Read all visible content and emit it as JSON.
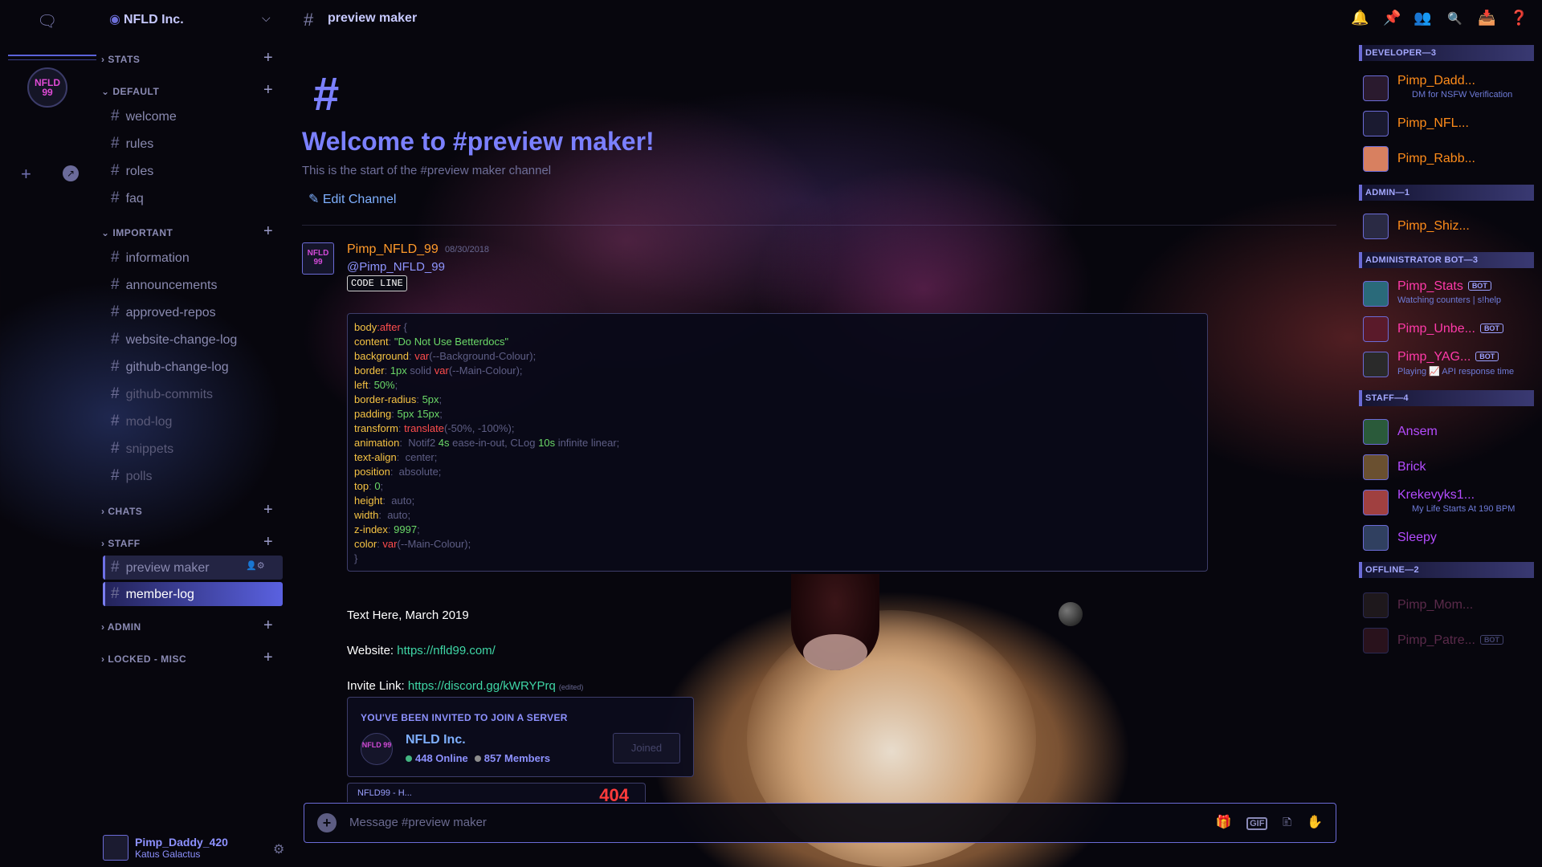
{
  "server": {
    "name": "NFLD Inc.",
    "icon_text": "NFLD 99"
  },
  "rail": {
    "dm_icon": "chat-bubble-icon",
    "add_icon": "+",
    "explore_icon": "compass-icon"
  },
  "categories": [
    {
      "name": "STATS",
      "channels": []
    },
    {
      "name": "DEFAULT",
      "channels": [
        "welcome",
        "rules",
        "roles",
        "faq"
      ]
    },
    {
      "name": "IMPORTANT",
      "channels": [
        "information",
        "announcements",
        "approved-repos",
        "website-change-log",
        "github-change-log",
        "github-commits",
        "mod-log",
        "snippets",
        "polls"
      ]
    },
    {
      "name": "CHATS",
      "channels": []
    },
    {
      "name": "STAFF",
      "channels": [
        "preview maker",
        "member-log"
      ]
    },
    {
      "name": "ADMIN",
      "channels": []
    },
    {
      "name": "LOCKED - MISC",
      "channels": []
    }
  ],
  "user_panel": {
    "name": "Pimp_Daddy_420",
    "status": "Katus Galactus"
  },
  "header": {
    "channel": "preview maker"
  },
  "welcome": {
    "title": "Welcome to #preview maker!",
    "subtitle": "This is the start of the #preview maker channel",
    "edit": "Edit Channel"
  },
  "message": {
    "author": "Pimp_NFLD_99",
    "date": "08/30/2018",
    "mention": "@Pimp_NFLD_99",
    "code_inline": "CODE LINE",
    "text1": "Text Here, March 2019",
    "website_label": "Website:",
    "website_url": "https://nfld99.com/",
    "invite_label": "Invite Link:",
    "invite_url": "https://discord.gg/kWRYPrq",
    "edited": "(edited)"
  },
  "code_block": {
    "selector": "body",
    "pseudo": ":after",
    "open": " {",
    "close": "}",
    "lines": [
      {
        "prop": "content",
        "val": "\"Do Not Use Betterdocs\"",
        "kind": "s"
      },
      {
        "prop": "background",
        "fn": "var",
        "arg": "(--Background-Colour);"
      },
      {
        "prop": "border",
        "num": "1px",
        "rest": " solid ",
        "fn": "var",
        "arg": "(--Main-Colour);"
      },
      {
        "prop": "left",
        "num": "50%",
        "rest": ";"
      },
      {
        "prop": "border-radius",
        "num": "5px",
        "rest": ";"
      },
      {
        "prop": "padding",
        "num": "5px 15px",
        "rest": ";"
      },
      {
        "prop": "transform",
        "fn": "translate",
        "arg": "(-50%, -100%);"
      },
      {
        "prop": "animation",
        "rest": " Notif2 ",
        "num": "4s",
        "rest2": " ease-in-out, CLog ",
        "num2": "10s",
        "rest3": " infinite linear;"
      },
      {
        "prop": "text-align",
        "rest": " center;"
      },
      {
        "prop": "position",
        "rest": " absolute;"
      },
      {
        "prop": "top",
        "num": "0",
        "rest": ";"
      },
      {
        "prop": "height",
        "rest": " auto;"
      },
      {
        "prop": "width",
        "rest": " auto;"
      },
      {
        "prop": "z-index",
        "num": "9997",
        "rest": ";"
      },
      {
        "prop": "color",
        "fn": "var",
        "arg": "(--Main-Colour);"
      }
    ]
  },
  "invite": {
    "heading": "YOU'VE BEEN INVITED TO JOIN A SERVER",
    "name": "NFLD Inc.",
    "online": "448 Online",
    "members": "857 Members",
    "button": "Joined"
  },
  "embed_peek": {
    "title": "NFLD99 - H...",
    "number": "404"
  },
  "input": {
    "placeholder": "Message #preview maker"
  },
  "members": {
    "groups": [
      {
        "heading": "DEVELOPER—3",
        "items": [
          {
            "name": "Pimp_Dadd...",
            "sub": "DM for NSFW Verification",
            "color": "orange"
          },
          {
            "name": "Pimp_NFL...",
            "sub": "",
            "color": "orange"
          },
          {
            "name": "Pimp_Rabb...",
            "sub": "",
            "color": "orange"
          }
        ]
      },
      {
        "heading": "ADMIN—1",
        "items": [
          {
            "name": "Pimp_Shiz...",
            "sub": "",
            "color": "orange"
          }
        ]
      },
      {
        "heading": "ADMINISTRATOR BOT—3",
        "items": [
          {
            "name": "Pimp_Stats",
            "sub": "Watching counters | s!help",
            "color": "pink",
            "bot": "BOT"
          },
          {
            "name": "Pimp_Unbe...",
            "sub": "",
            "color": "pink",
            "bot": "BOT"
          },
          {
            "name": "Pimp_YAG...",
            "sub": "Playing 📈 API response time",
            "color": "pink",
            "bot": "BOT"
          }
        ]
      },
      {
        "heading": "STAFF—4",
        "items": [
          {
            "name": "Ansem",
            "sub": "",
            "color": "purple"
          },
          {
            "name": "Brick",
            "sub": "",
            "color": "purple"
          },
          {
            "name": "Krekevyks1...",
            "sub": "My Life Starts At 190 BPM",
            "color": "purple"
          },
          {
            "name": "Sleepy",
            "sub": "",
            "color": "purple"
          }
        ]
      },
      {
        "heading": "OFFLINE—2",
        "items": [
          {
            "name": "Pimp_Mom...",
            "sub": "",
            "color": "offline"
          },
          {
            "name": "Pimp_Patre...",
            "sub": "",
            "color": "offline",
            "bot": "BOT"
          }
        ]
      }
    ]
  }
}
